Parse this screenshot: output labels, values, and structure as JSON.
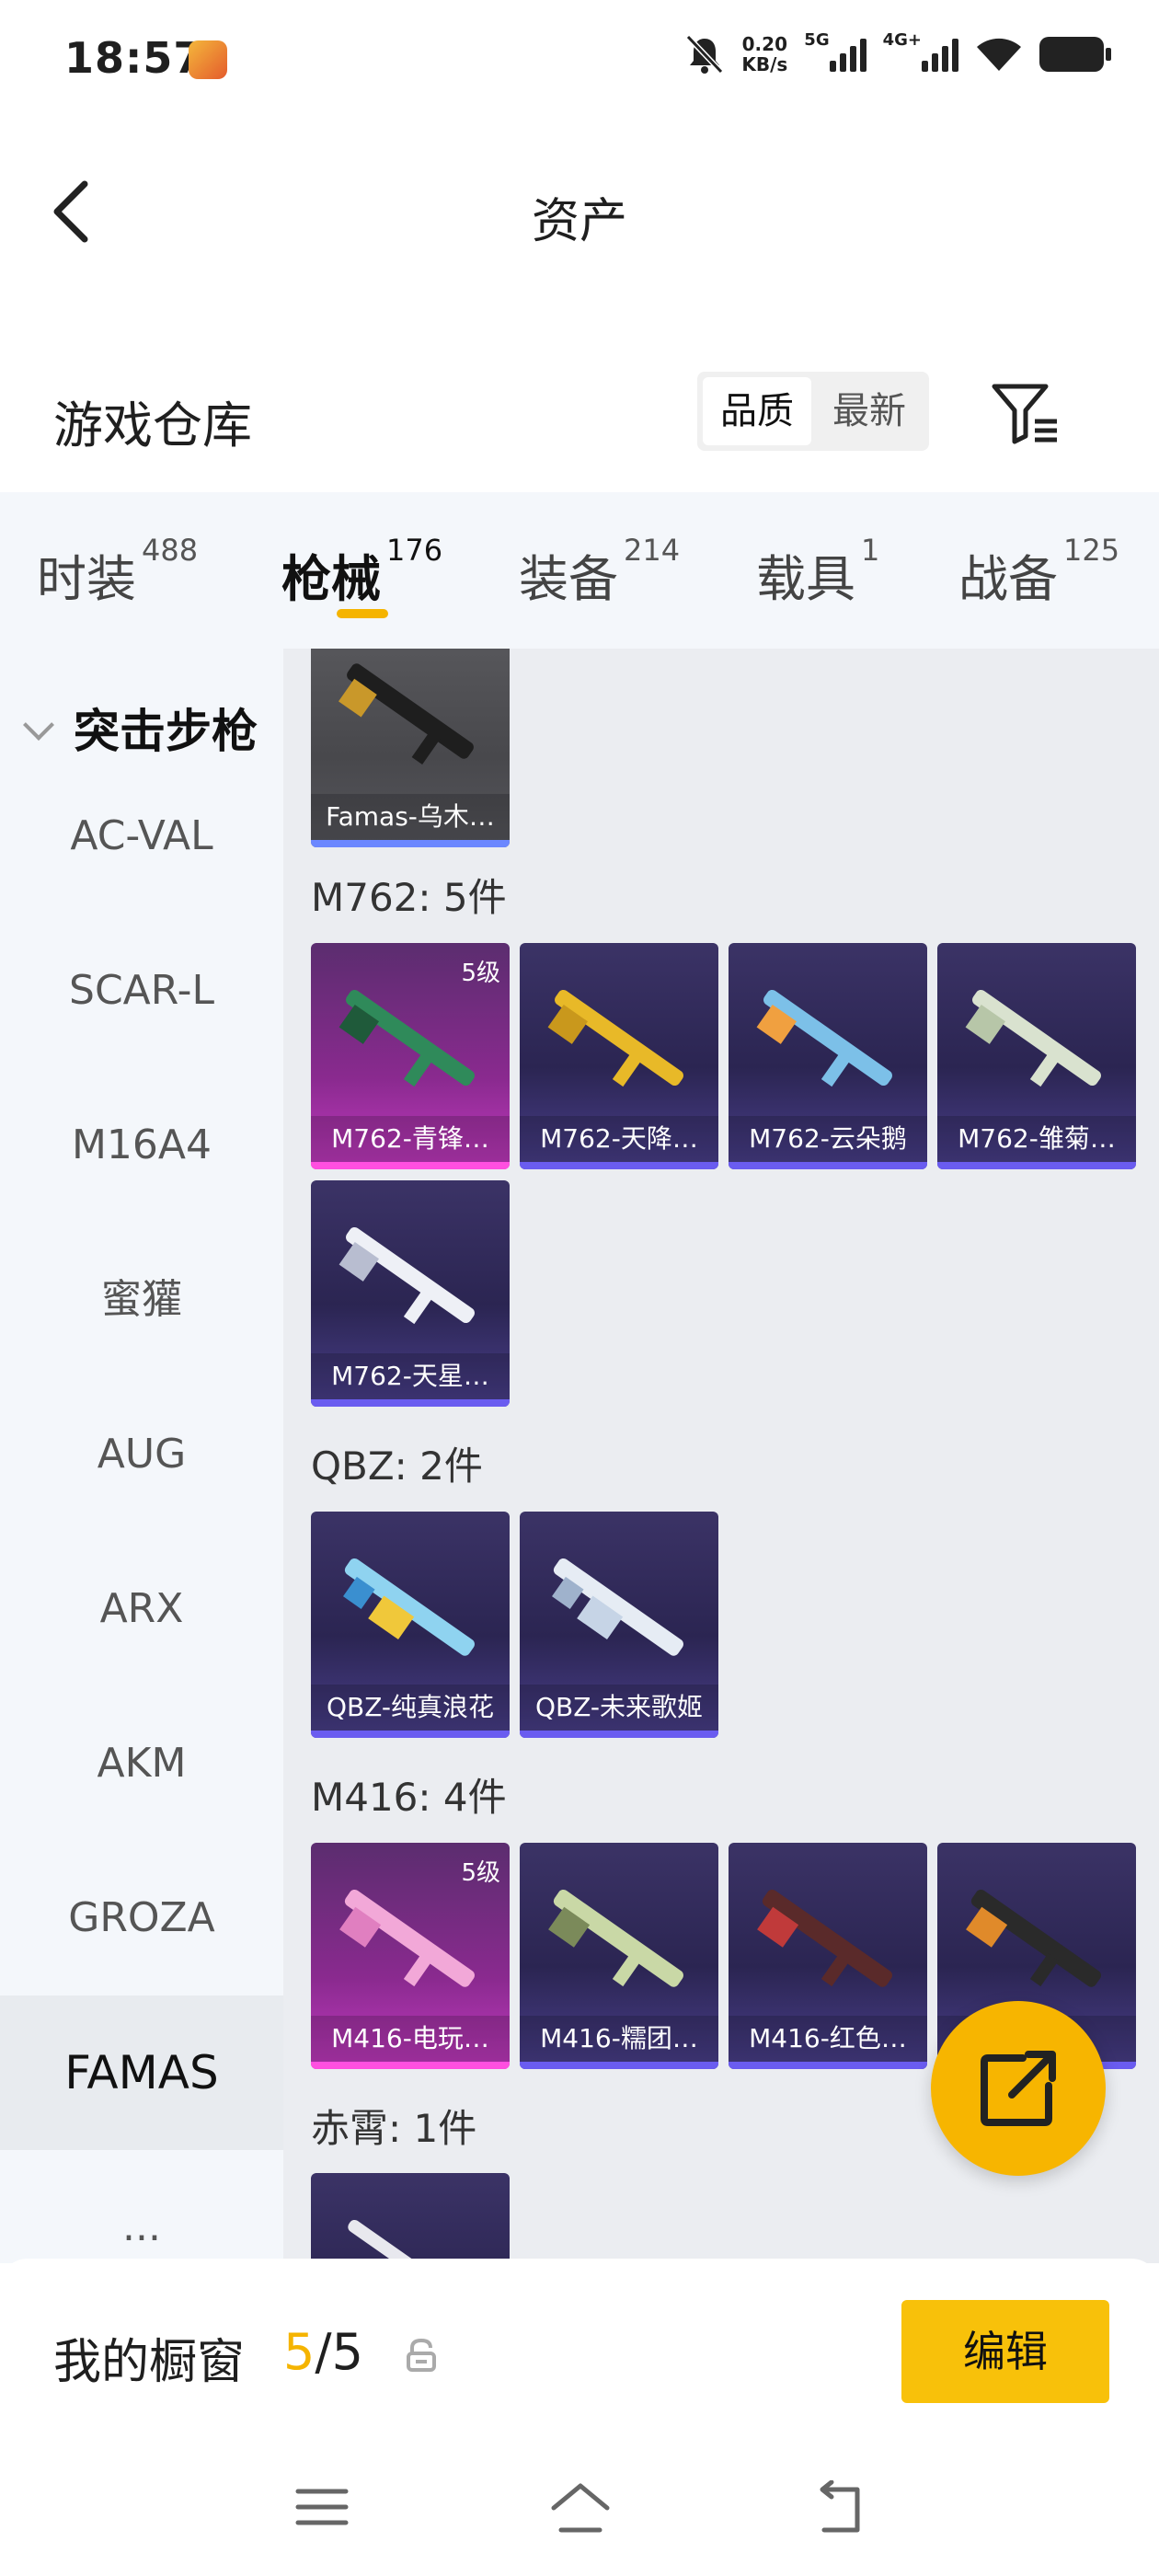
{
  "status": {
    "time": "18:57",
    "net_speed_value": "0.20",
    "net_speed_unit": "KB/s",
    "signal1_label": "5G",
    "signal2_label": "4G+"
  },
  "header": {
    "title": "资产"
  },
  "warehouse": {
    "title": "游戏仓库",
    "sort_options": [
      "品质",
      "最新"
    ],
    "selected_sort": "品质"
  },
  "tabs": [
    {
      "label": "时装",
      "count": "488"
    },
    {
      "label": "枪械",
      "count": "176",
      "active": true
    },
    {
      "label": "装备",
      "count": "214"
    },
    {
      "label": "载具",
      "count": "1"
    },
    {
      "label": "战备",
      "count": "125"
    }
  ],
  "sidebar": {
    "group": "突击步枪",
    "items": [
      "AC-VAL",
      "SCAR-L",
      "M16A4",
      "蜜獾",
      "AUG",
      "ARX",
      "AKM",
      "GROZA",
      "FAMAS",
      "..."
    ],
    "active": "FAMAS"
  },
  "content": {
    "top_card": {
      "name": "Famas-乌木…"
    },
    "groups": [
      {
        "label": "M762: 5件",
        "items": [
          {
            "name": "M762-青锋…",
            "level": "5级"
          },
          {
            "name": "M762-天降…"
          },
          {
            "name": "M762-云朵鹅"
          },
          {
            "name": "M762-雏菊…"
          },
          {
            "name": "M762-天星…"
          }
        ]
      },
      {
        "label": "QBZ: 2件",
        "items": [
          {
            "name": "QBZ-纯真浪花"
          },
          {
            "name": "QBZ-未来歌姬"
          }
        ]
      },
      {
        "label": "M416: 4件",
        "items": [
          {
            "name": "M416-电玩…",
            "level": "5级"
          },
          {
            "name": "M416-糯团…"
          },
          {
            "name": "M416-红色…"
          },
          {
            "name": "…"
          }
        ]
      },
      {
        "label": "赤霄: 1件",
        "items": []
      }
    ]
  },
  "showcase": {
    "title": "我的橱窗",
    "current": "5",
    "separator": "/",
    "total": "5",
    "edit_label": "编辑"
  },
  "colors": {
    "accent": "#f5b400",
    "card_purple": "#2b2552",
    "card_pink": "#c23ac0",
    "card_gray": "#4a4a4e"
  }
}
